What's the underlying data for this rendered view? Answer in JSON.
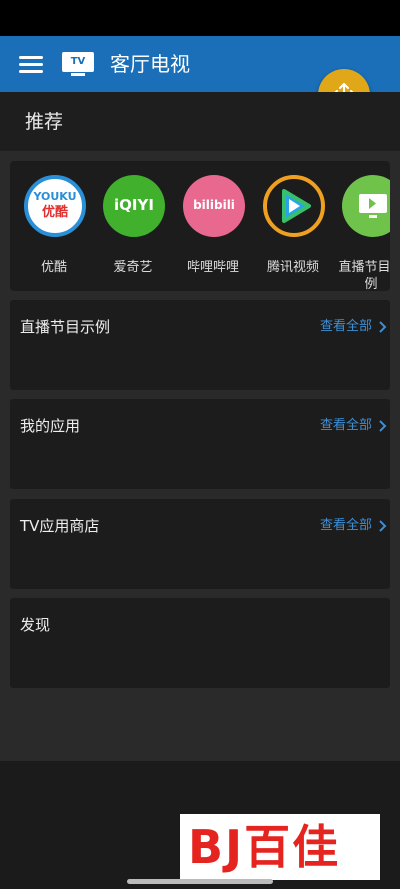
{
  "header": {
    "title": "客厅电视",
    "tv_logo_text": "TV",
    "menu_icon": "hamburger-menu-icon",
    "fab_icon": "move-arrows-icon",
    "fab_color": "#e0a818",
    "bar_color": "#1a6fb8"
  },
  "section": {
    "title": "推荐"
  },
  "recommended_apps": [
    {
      "label": "优酷",
      "logo_top": "YOUKU",
      "logo_bottom": "优酷",
      "color": "#2a8fd6"
    },
    {
      "label": "爱奇艺",
      "logo": "iQIYI",
      "color": "#41b02c"
    },
    {
      "label": "哔哩哔哩",
      "logo": "bilibili",
      "color": "#e9688f"
    },
    {
      "label": "腾讯视频",
      "icon": "tencent-video-icon",
      "color": "#f0a020"
    },
    {
      "label": "直播节目示例",
      "icon": "tv-icon",
      "color": "#6fc34a"
    }
  ],
  "cards": [
    {
      "title": "直播节目示例",
      "see_all": "查看全部"
    },
    {
      "title": "我的应用",
      "see_all": "查看全部"
    },
    {
      "title": "TV应用商店",
      "see_all": "查看全部"
    },
    {
      "title": "发现"
    }
  ],
  "watermark": {
    "text": "BJ百佳"
  }
}
